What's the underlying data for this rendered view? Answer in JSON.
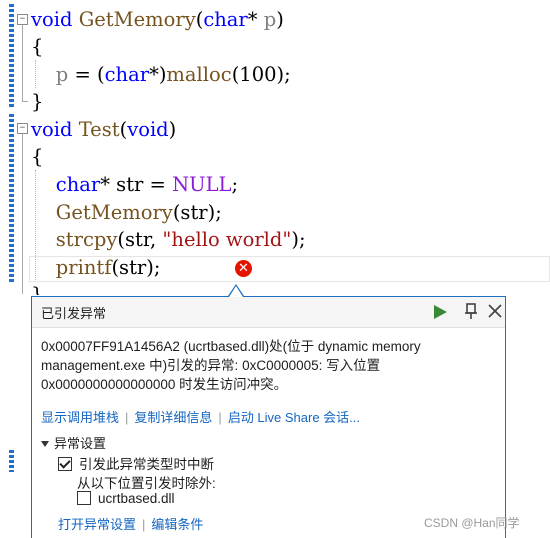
{
  "code": {
    "l1": {
      "kw": "void",
      "fn": "GetMemory",
      "open": "(",
      "kw2": "char",
      "star": "*",
      "param": " p",
      "close": ")"
    },
    "l2": "{",
    "l3": {
      "param": "p",
      "eq": " = (",
      "kw": "char",
      "mid": "*)",
      "fn": "malloc",
      "rest": "(100);"
    },
    "l4": "}",
    "l5": {
      "kw": "void",
      "fn": "Test",
      "open": "(",
      "kw2": "void",
      "close": ")"
    },
    "l6": "{",
    "l7": {
      "kw": "char",
      "rest": "* str = ",
      "mac": "NULL",
      "end": ";"
    },
    "l8": {
      "fn": "GetMemory",
      "rest": "(str);"
    },
    "l9": {
      "fn": "strcpy",
      "rest": "(str, ",
      "str": "\"hello world\"",
      "end": ");"
    },
    "l10": {
      "fn": "printf",
      "rest": "(str);"
    },
    "l11": "}"
  },
  "popup": {
    "title": "已引发异常",
    "message_line1": "0x00007FF91A1456A2 (ucrtbased.dll)处(位于 dynamic memory",
    "message_line2": "management.exe 中)引发的异常: 0xC0000005: 写入位置",
    "message_line3": "0x0000000000000000 时发生访问冲突。",
    "links": [
      "显示调用堆栈",
      "复制详细信息",
      "启动 Live Share 会话..."
    ],
    "section_title": "异常设置",
    "break_checkbox_label": "引发此异常类型时中断",
    "except_label": "从以下位置引发时除外:",
    "dll_checkbox_label": "ucrtbased.dll",
    "bottom_links": [
      "打开异常设置",
      "编辑条件"
    ]
  },
  "watermark": "CSDN @Han同学",
  "colors": {
    "keyword": "#0000ff",
    "macro": "#8a1bd6",
    "function": "#74531f",
    "string": "#a31515",
    "accent": "#1d6fc4",
    "error": "#e51400"
  }
}
